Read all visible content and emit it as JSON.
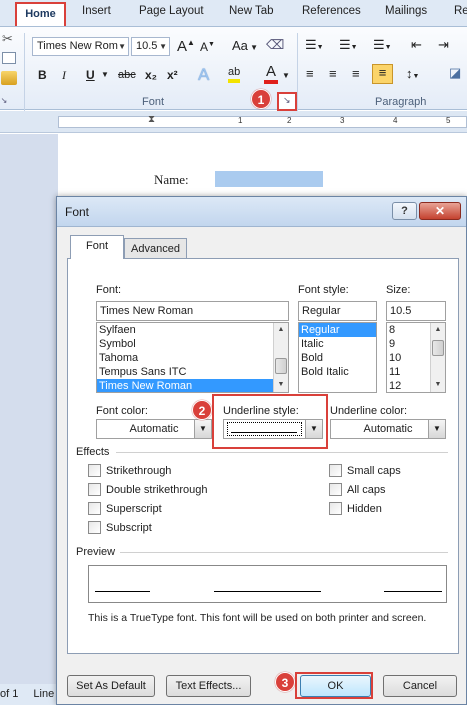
{
  "ribbon": {
    "tabs": [
      "Home",
      "Insert",
      "Page Layout",
      "New Tab",
      "References",
      "Mailings",
      "Re"
    ],
    "font_name": "Times New Rom",
    "font_size": "10.5",
    "font_group_label": "Font",
    "paragraph_group_label": "Paragraph",
    "grow_font": "A",
    "shrink_font": "A",
    "change_case": "Aa",
    "bold": "B",
    "italic": "I",
    "underline": "U",
    "strikethrough": "abc",
    "subscript": "x₂",
    "superscript": "x²",
    "text_effects": "A",
    "highlight": "ab",
    "font_color": "A"
  },
  "document": {
    "name_label": "Name:",
    "status_page": "of 1",
    "status_line": "Line"
  },
  "callouts": [
    "1",
    "2",
    "3"
  ],
  "dialog": {
    "title": "Font",
    "help": "?",
    "close": "✕",
    "tabs": [
      "Font",
      "Advanced"
    ],
    "font_label": "Font:",
    "font_value": "Times New Roman",
    "font_list": [
      "Sylfaen",
      "Symbol",
      "Tahoma",
      "Tempus Sans ITC",
      "Times New Roman"
    ],
    "font_list_selected": 4,
    "style_label": "Font style:",
    "style_value": "Regular",
    "style_list": [
      "Regular",
      "Italic",
      "Bold",
      "Bold Italic"
    ],
    "style_list_selected": 0,
    "size_label": "Size:",
    "size_value": "10.5",
    "size_list": [
      "8",
      "9",
      "10",
      "11",
      "12"
    ],
    "font_color_label": "Font color:",
    "font_color_value": "Automatic",
    "underline_style_label": "Underline style:",
    "underline_color_label": "Underline color:",
    "underline_color_value": "Automatic",
    "effects_title": "Effects",
    "effects": [
      "Strikethrough",
      "Double strikethrough",
      "Superscript",
      "Subscript",
      "Small caps",
      "All caps",
      "Hidden"
    ],
    "preview_title": "Preview",
    "preview_note": "This is a TrueType font. This font will be used on both printer and screen.",
    "set_default": "Set As Default",
    "text_effects": "Text Effects...",
    "ok": "OK",
    "cancel": "Cancel"
  },
  "colors": {
    "callout_red": "#d9403a",
    "selection_blue": "#3399ff",
    "ribbon_bg": "#dfe9f5",
    "name_field": "#aacbef"
  }
}
